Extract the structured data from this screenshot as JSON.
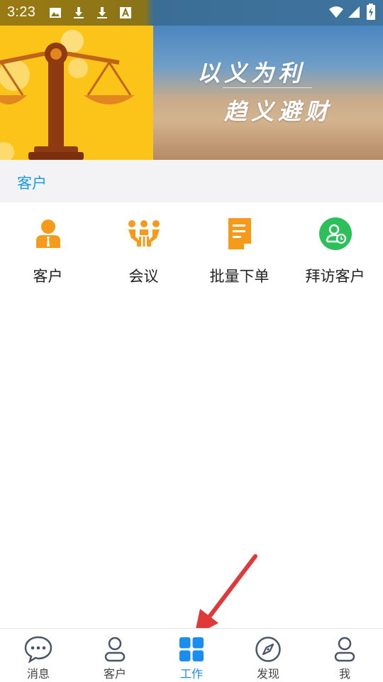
{
  "status_bar": {
    "time": "3:23"
  },
  "banner": {
    "slogan_line1": "以义为利",
    "slogan_line2": "趋义避财"
  },
  "section": {
    "title": "客户"
  },
  "grid_items": [
    {
      "label": "客户",
      "icon": "customer-icon",
      "color": "#f59a1b"
    },
    {
      "label": "会议",
      "icon": "meeting-icon",
      "color": "#f59a1b"
    },
    {
      "label": "批量下单",
      "icon": "batch-order-icon",
      "color": "#f59a1b"
    },
    {
      "label": "拜访客户",
      "icon": "visit-customer-icon",
      "color": "#2bc05a"
    }
  ],
  "bottom_nav": [
    {
      "label": "消息",
      "icon": "chat-bubble-icon",
      "active": false
    },
    {
      "label": "客户",
      "icon": "person-icon",
      "active": false
    },
    {
      "label": "工作",
      "icon": "grid-apps-icon",
      "active": true
    },
    {
      "label": "发现",
      "icon": "compass-icon",
      "active": false
    },
    {
      "label": "我",
      "icon": "profile-icon",
      "active": false
    }
  ],
  "colors": {
    "accent": "#1a8ef0",
    "section_title": "#1a9be0",
    "annotation_arrow": "#e0393b"
  }
}
